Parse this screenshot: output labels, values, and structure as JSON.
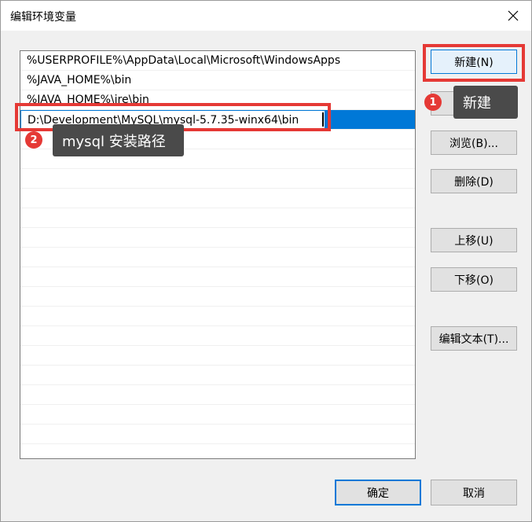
{
  "window": {
    "title": "编辑环境变量"
  },
  "list": {
    "items": [
      "%USERPROFILE%\\AppData\\Local\\Microsoft\\WindowsApps",
      "%JAVA_HOME%\\bin",
      "%JAVA_HOME%\\jre\\bin",
      "D:\\Development\\MySQL\\mysql-5.7.35-winx64\\bin"
    ]
  },
  "buttons": {
    "new": "新建(N)",
    "edit": "编辑(E)",
    "browse": "浏览(B)...",
    "delete": "删除(D)",
    "move_up": "上移(U)",
    "move_down": "下移(O)",
    "edit_text": "编辑文本(T)...",
    "ok": "确定",
    "cancel": "取消"
  },
  "annotations": {
    "marker1": "1",
    "callout1": "新建",
    "marker2": "2",
    "callout2": "mysql 安装路径"
  },
  "colors": {
    "selection": "#0078d7",
    "annotation_red": "#e53935",
    "callout_bg": "#4a4a4a"
  }
}
